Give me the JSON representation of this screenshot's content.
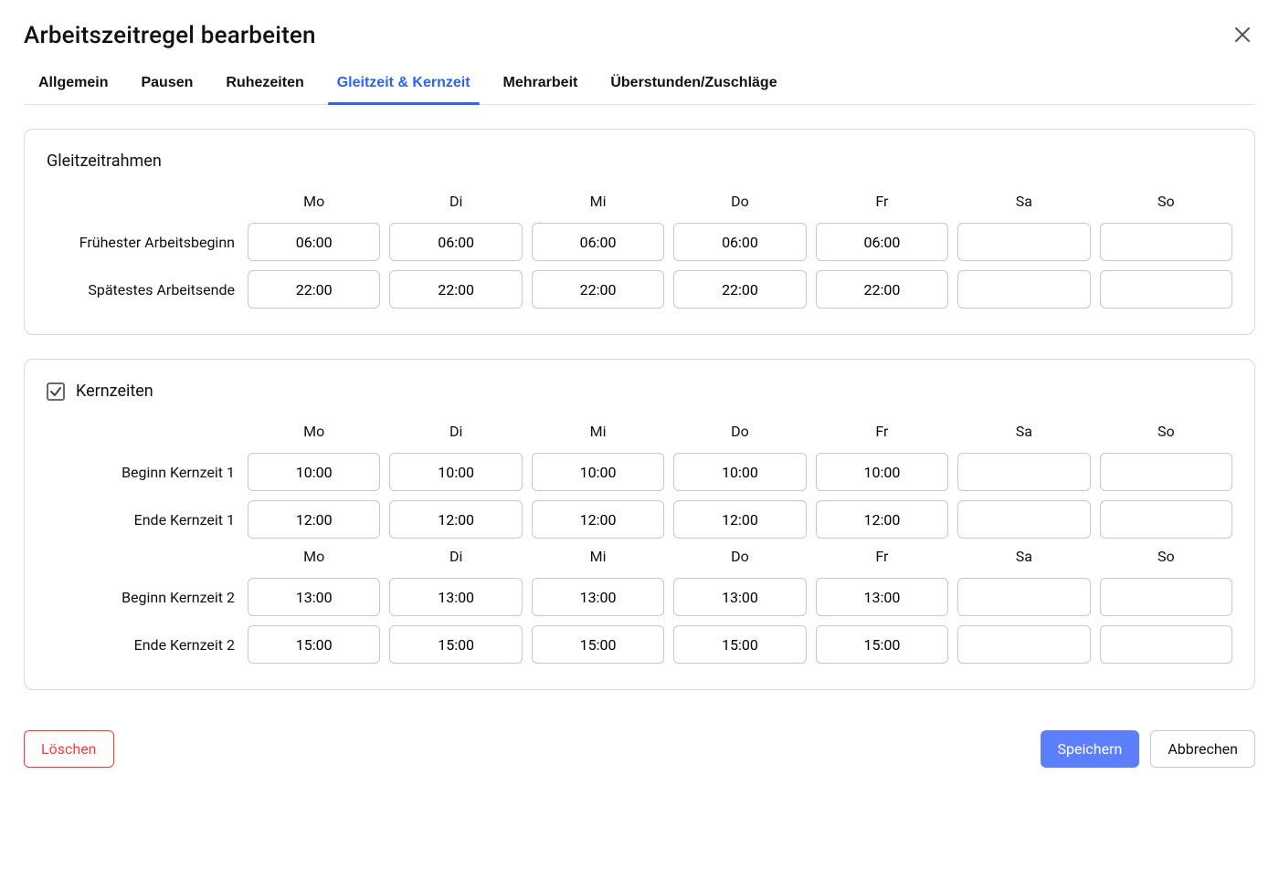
{
  "title": "Arbeitszeitregel bearbeiten",
  "tabs": [
    {
      "label": "Allgemein",
      "active": false
    },
    {
      "label": "Pausen",
      "active": false
    },
    {
      "label": "Ruhezeiten",
      "active": false
    },
    {
      "label": "Gleitzeit & Kernzeit",
      "active": true
    },
    {
      "label": "Mehrarbeit",
      "active": false
    },
    {
      "label": "Überstunden/Zuschläge",
      "active": false
    }
  ],
  "days": [
    "Mo",
    "Di",
    "Mi",
    "Do",
    "Fr",
    "Sa",
    "So"
  ],
  "gleitzeit": {
    "title": "Gleitzeitrahmen",
    "rows": {
      "earliest_label": "Frühester Arbeitsbeginn",
      "latest_label": "Spätestes Arbeitsende",
      "earliest": [
        "06:00",
        "06:00",
        "06:00",
        "06:00",
        "06:00",
        "",
        ""
      ],
      "latest": [
        "22:00",
        "22:00",
        "22:00",
        "22:00",
        "22:00",
        "",
        ""
      ]
    }
  },
  "kernzeiten": {
    "title": "Kernzeiten",
    "enabled": true,
    "k1_start_label": "Beginn Kernzeit 1",
    "k1_end_label": "Ende Kernzeit 1",
    "k2_start_label": "Beginn Kernzeit 2",
    "k2_end_label": "Ende Kernzeit 2",
    "k1_start": [
      "10:00",
      "10:00",
      "10:00",
      "10:00",
      "10:00",
      "",
      ""
    ],
    "k1_end": [
      "12:00",
      "12:00",
      "12:00",
      "12:00",
      "12:00",
      "",
      ""
    ],
    "k2_start": [
      "13:00",
      "13:00",
      "13:00",
      "13:00",
      "13:00",
      "",
      ""
    ],
    "k2_end": [
      "15:00",
      "15:00",
      "15:00",
      "15:00",
      "15:00",
      "",
      ""
    ]
  },
  "buttons": {
    "delete": "Löschen",
    "save": "Speichern",
    "cancel": "Abbrechen"
  }
}
